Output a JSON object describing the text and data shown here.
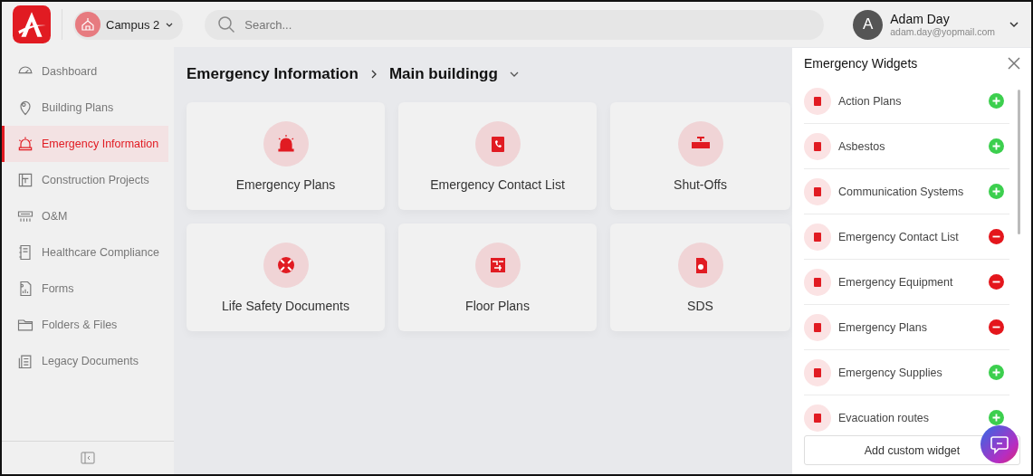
{
  "header": {
    "campus": "Campus 2",
    "search": {
      "placeholder": "Search..."
    },
    "user": {
      "initial": "A",
      "name": "Adam Day",
      "email": "adam.day@yopmail.com"
    }
  },
  "sidebar": {
    "items": [
      {
        "label": "Dashboard",
        "selected": false
      },
      {
        "label": "Building Plans",
        "selected": false
      },
      {
        "label": "Emergency Information",
        "selected": true
      },
      {
        "label": "Construction Projects",
        "selected": false
      },
      {
        "label": "O&M",
        "selected": false
      },
      {
        "label": "Healthcare Compliance",
        "selected": false
      },
      {
        "label": "Forms",
        "selected": false
      },
      {
        "label": "Folders & Files",
        "selected": false
      },
      {
        "label": "Legacy Documents",
        "selected": false
      }
    ]
  },
  "breadcrumb": [
    "Emergency Information",
    "Main buildingg"
  ],
  "cards": [
    {
      "label": "Emergency Plans"
    },
    {
      "label": "Emergency Contact List"
    },
    {
      "label": "Shut-Offs"
    },
    {
      "label": "Life Safety Documents"
    },
    {
      "label": "Floor Plans"
    },
    {
      "label": "SDS"
    }
  ],
  "panel": {
    "title": "Emergency Widgets",
    "widgets": [
      {
        "label": "Action Plans",
        "added": false
      },
      {
        "label": "Asbestos",
        "added": false
      },
      {
        "label": "Communication Systems",
        "added": false
      },
      {
        "label": "Emergency Contact List",
        "added": true
      },
      {
        "label": "Emergency Equipment",
        "added": true
      },
      {
        "label": "Emergency Plans",
        "added": true
      },
      {
        "label": "Emergency Supplies",
        "added": false
      },
      {
        "label": "Evacuation routes",
        "added": false
      }
    ],
    "add_button": "Add custom widget"
  }
}
